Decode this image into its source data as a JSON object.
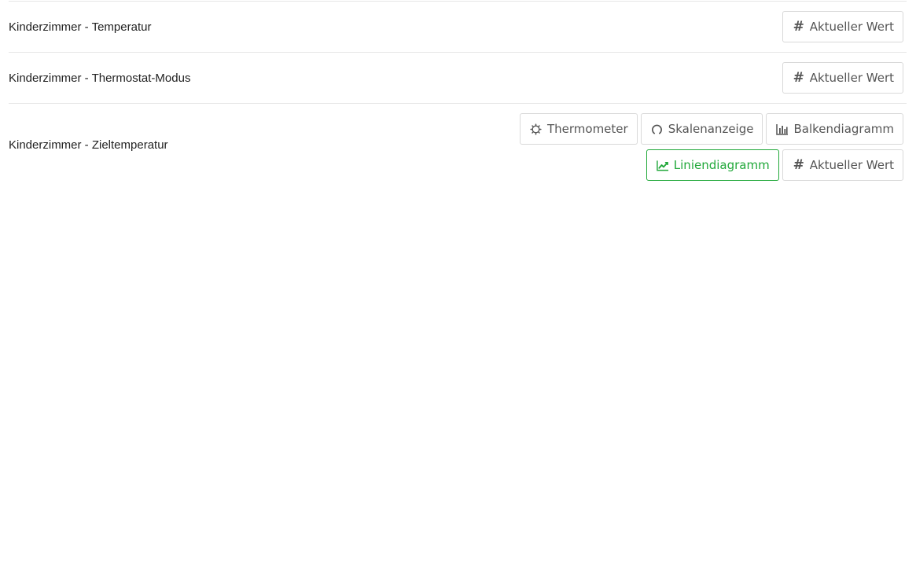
{
  "rows": [
    {
      "label": "Kinderzimmer - Temperatur",
      "buttons": [
        {
          "label": "Aktueller Wert",
          "icon": "hash-icon",
          "active": false
        }
      ]
    },
    {
      "label": "Kinderzimmer - Thermostat-Modus",
      "buttons": [
        {
          "label": "Aktueller Wert",
          "icon": "hash-icon",
          "active": false
        }
      ]
    },
    {
      "label": "Kinderzimmer - Zieltemperatur",
      "buttons": [
        {
          "label": "Thermometer",
          "icon": "gear-icon",
          "active": false
        },
        {
          "label": "Skalenanzeige",
          "icon": "gauge-icon",
          "active": false
        },
        {
          "label": "Balkendiagramm",
          "icon": "bar-chart-icon",
          "active": false
        },
        {
          "label": "Liniendiagramm",
          "icon": "line-chart-icon",
          "active": true
        },
        {
          "label": "Aktueller Wert",
          "icon": "hash-icon",
          "active": false
        }
      ]
    }
  ],
  "colors": {
    "active": "#21a83a",
    "border": "#d9d9d9",
    "divider": "#e6e6e6",
    "text": "#555555"
  }
}
